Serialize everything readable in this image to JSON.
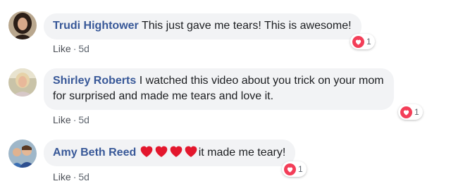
{
  "comments": [
    {
      "author": "Trudi Hightower",
      "text": "This just gave me tears! This is awesome!",
      "like_label": "Like",
      "separator": "·",
      "time": "5d",
      "reaction_count": "1",
      "reaction_icon": "love-icon"
    },
    {
      "author": "Shirley Roberts",
      "text_line1": "I watched this video about you trick on your mom",
      "text_line2": "for surprised and made me tears and love it.",
      "like_label": "Like",
      "separator": "·",
      "time": "5d",
      "reaction_count": "1",
      "reaction_icon": "love-icon"
    },
    {
      "author": "Amy Beth Reed",
      "emoji": [
        "red-heart-emoji",
        "red-heart-emoji",
        "red-heart-emoji",
        "red-heart-emoji"
      ],
      "text": "it made me teary!",
      "like_label": "Like",
      "separator": "·",
      "time": "5d",
      "reaction_count": "1",
      "reaction_icon": "love-icon"
    }
  ],
  "colors": {
    "author": "#385898",
    "bubble": "#f2f3f5",
    "love": "#f33e58",
    "meta": "#606770"
  }
}
